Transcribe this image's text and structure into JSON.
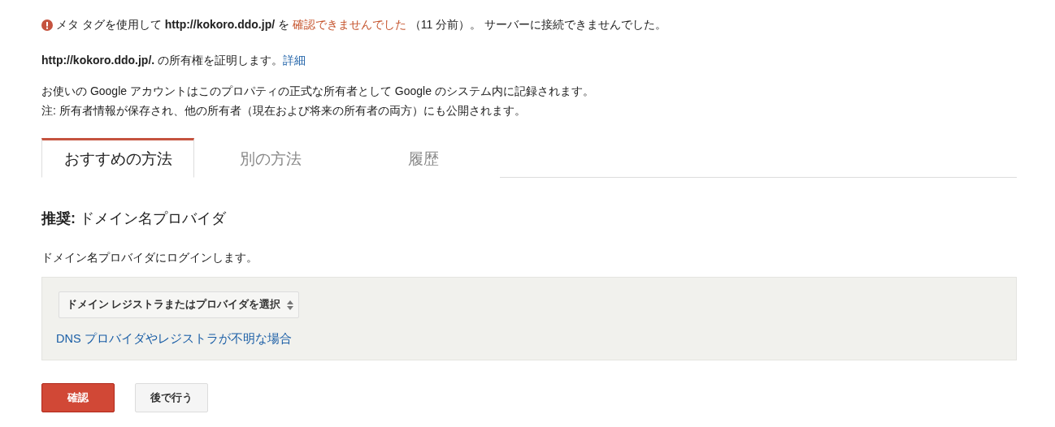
{
  "alert": {
    "before": "メタ タグを使用して **http://kokoro.ddo.jp/** を",
    "status": "確認できませんでした",
    "after": "（11 分前）。 サーバーに接続できませんでした。"
  },
  "ownership": {
    "text": "**http://kokoro.ddo.jp/.** の所有権を証明します。",
    "link": "詳細"
  },
  "notes": [
    "お使いの Google アカウントはこのプロパティの正式な所有者として Google のシステム内に記録されます。",
    "注: 所有者情報が保存され、他の所有者（現在および将来の所有者の両方）にも公開されます。"
  ],
  "tabs": [
    {
      "label": "おすすめの方法",
      "selected": true
    },
    {
      "label": "別の方法",
      "selected": false
    },
    {
      "label": "履歴",
      "selected": false
    }
  ],
  "heading": "**推奨:** ドメイン名プロバイダ",
  "instruction": "ドメイン名プロバイダにログインします。",
  "provider_select": {
    "value": "ドメイン レジストラまたはプロバイダを選択"
  },
  "help_link": "DNS プロバイダやレジストラが不明な場合",
  "buttons": [
    {
      "label": "確認",
      "kind": "primary"
    },
    {
      "label": "後で行う",
      "kind": "secondary"
    }
  ]
}
